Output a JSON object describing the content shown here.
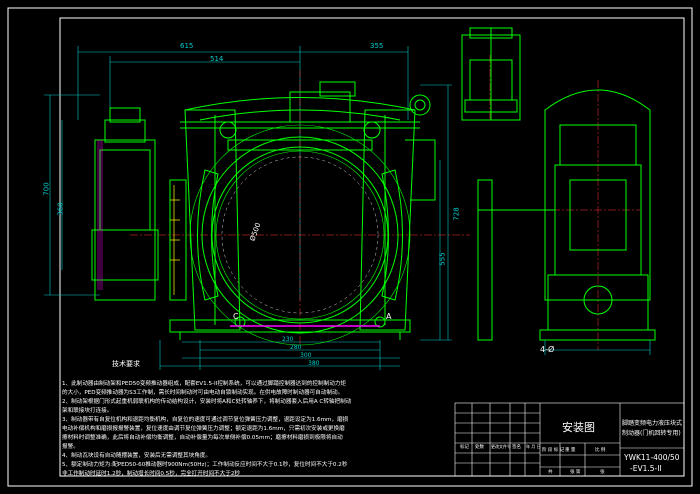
{
  "dimensions": {
    "top": [
      "615",
      "514",
      "355"
    ],
    "left": [
      "700",
      "360"
    ],
    "right": [
      "728",
      "555"
    ],
    "bottom": [
      "230",
      "280",
      "300",
      "380"
    ],
    "center_radius": "Ø500",
    "side_hole": "4-Ø"
  },
  "labels": {
    "point_c": "C",
    "point_a": "A"
  },
  "notes": {
    "title": "技术要求",
    "items": [
      "1、此制动器由制动架和PED50变频推动器组成，配套EV1.5-II控制系统，可以通过脚踏控制器达到的控制制动力矩",
      "的大小，PED变频推动器为S3工作制，需长时间制动时可由电动自锁制动实现。在供电故障时制动器可自动制动。",
      "2、制动架根据门形式起重机弱联机构的传动结构设计，安装时将A和C处转轴养下，将制动器套入后用A C转轴把制动",
      "架和联接块打连接。",
      "3、制动器带有自复位机构和退距均衡机构，自复位的速度可通过调节复位弹簧压力调整，退距设定为1.6mm，磨损",
      "电动补偿机构和磨损报报警装置，复位速度由调节复位弹簧压力调整；额定退距为1.6mm，只需初次安装或更换磨",
      "擦材料时调整准确，此后将自动补偿均衡调整，自动补偿量为每次单侧补偿0.05mm；磨擦材料磨损到极限将自动",
      "报警。",
      "4、制动瓦块设有自动随摆装置，安装后无需调整其块角度。",
      "5、额定制动力矩为:配PED50-60推动器时900Nm(50Hz)；工作制动反应时间不大于0.1秒，复位时间不大于0.2秒",
      "   非工作制动时延时1.2秒，制动增长时间0.5秒，完全打开时间不大于2秒"
    ]
  },
  "title_block": {
    "drawing_name": "安装图",
    "product_name_line1": "脚踏变频电力液压块式",
    "product_name_line2": "制动器(门机回转专用)",
    "model_line1": "YWK11-400/50",
    "model_line2": "-EV1.5-II",
    "grid_labels": [
      "标记",
      "处数",
      "更改文件号",
      "签名",
      "年 月 日"
    ],
    "stage_labels": [
      "阶 段 标 记",
      "重 量",
      "比 例"
    ],
    "sheet_labels": [
      "共",
      "张 第",
      "张"
    ]
  },
  "colors": {
    "background": "#000000",
    "frame": "#ffffff",
    "geometry": "#00ff00",
    "dimension": "#00cccc",
    "centerline": "#ff3333",
    "highlight": "#ffff00",
    "accent": "#ff00ff"
  }
}
